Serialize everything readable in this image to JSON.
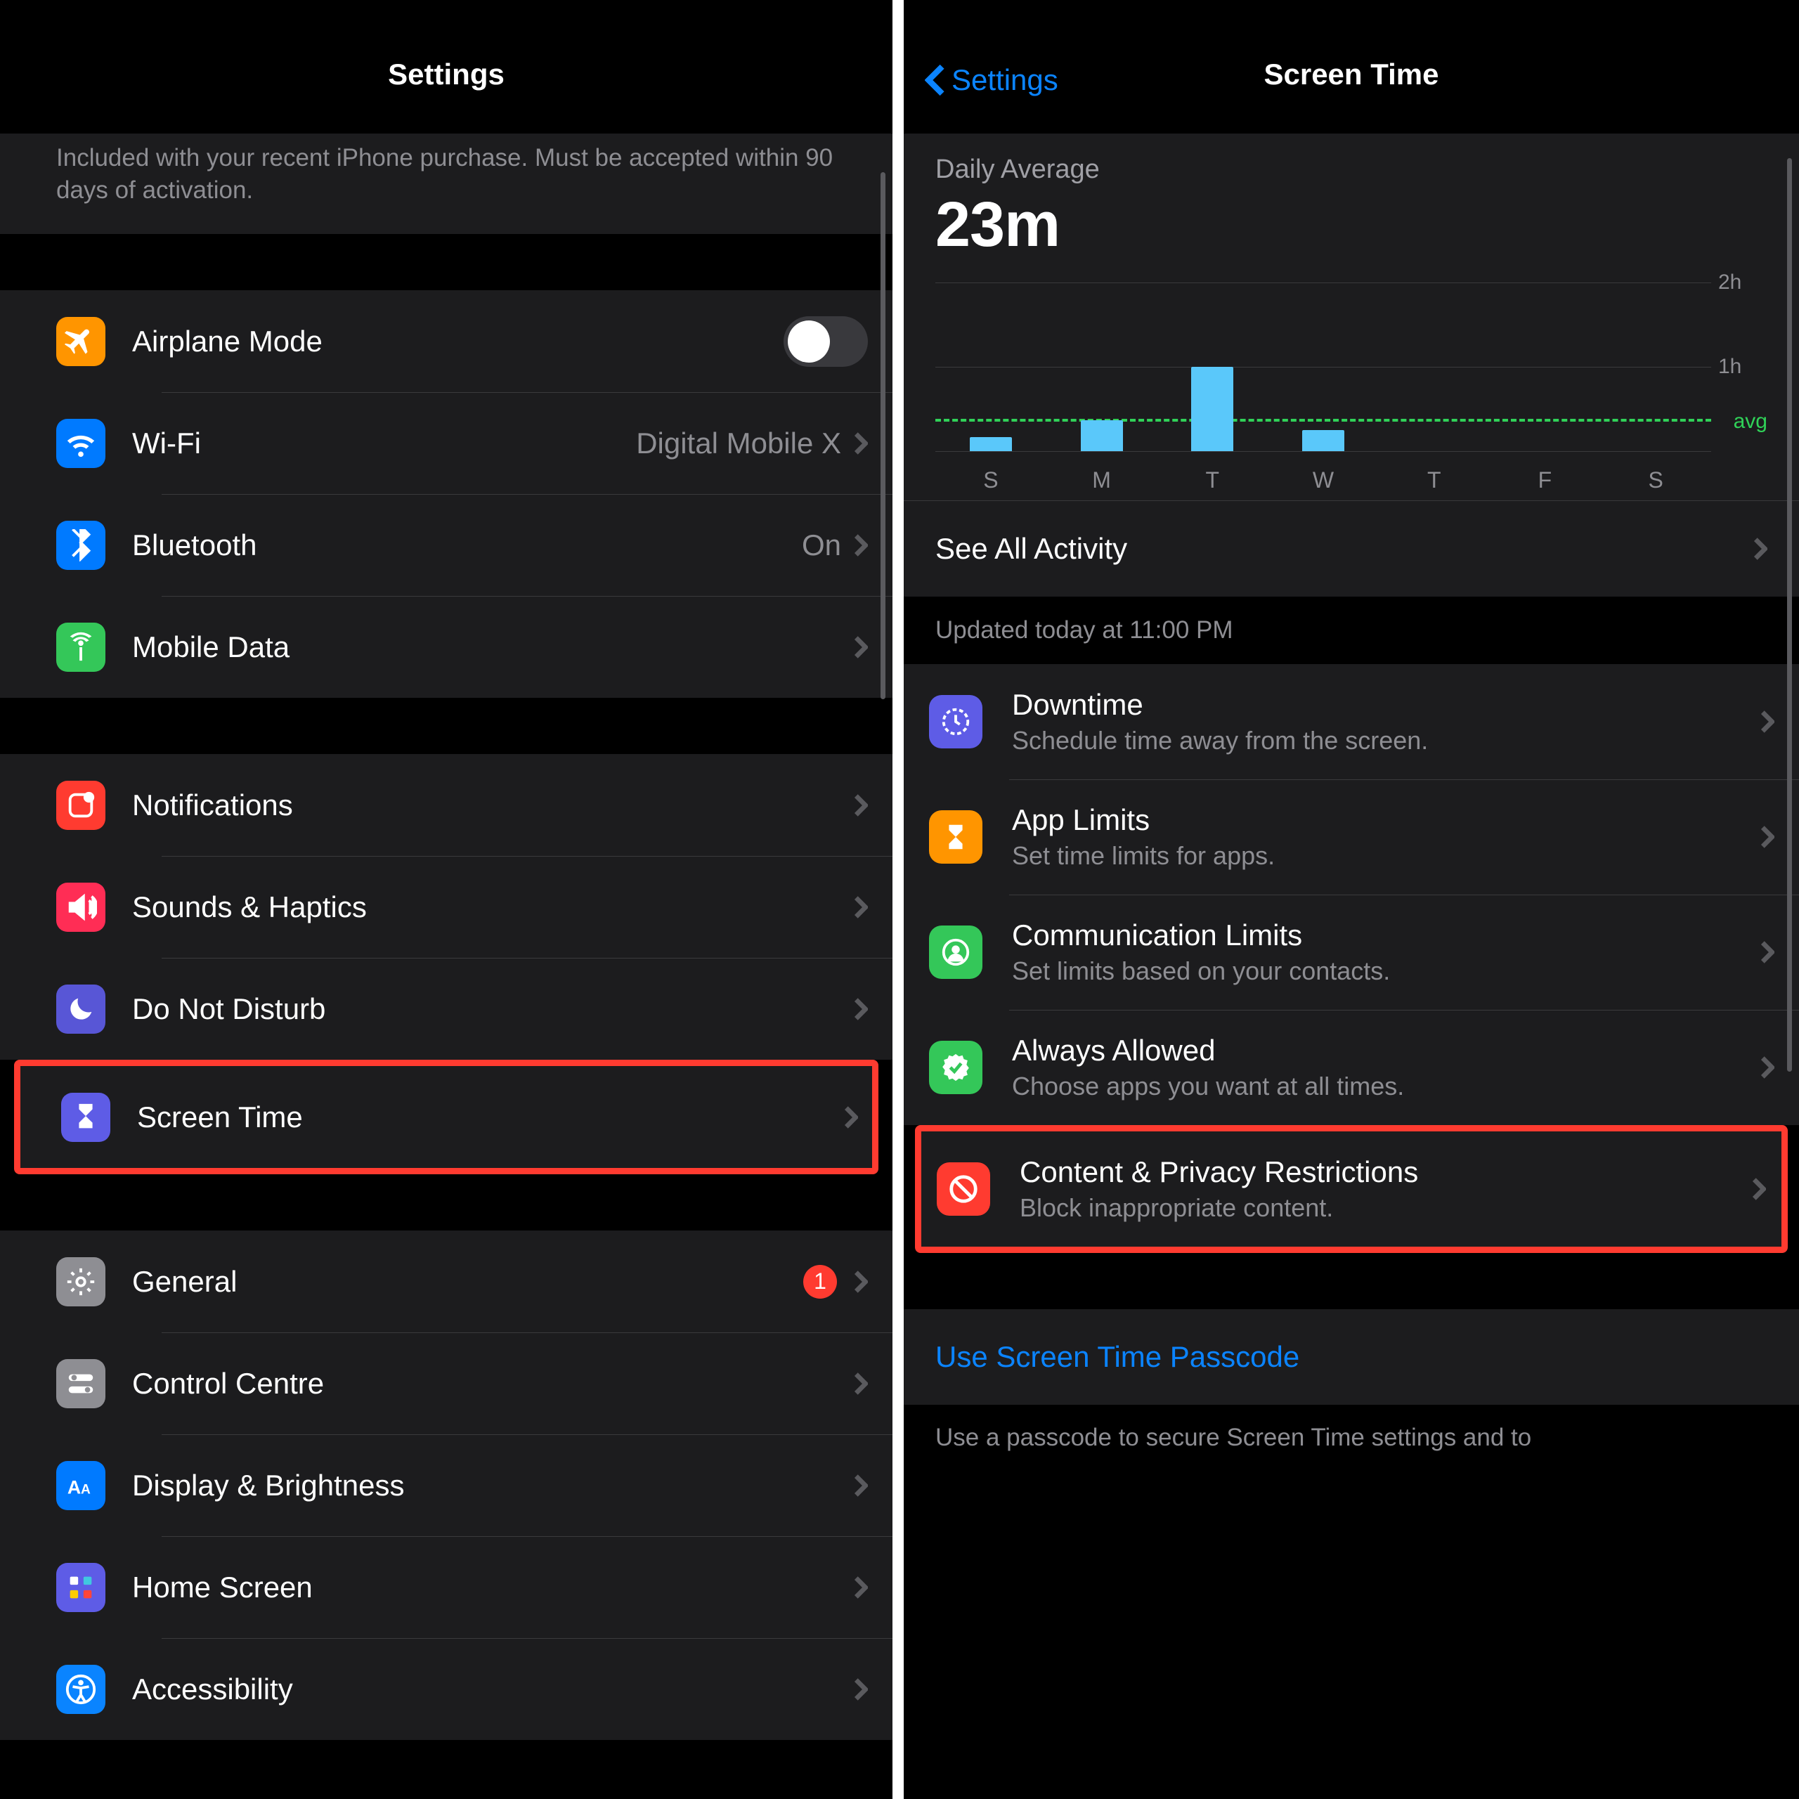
{
  "left": {
    "header_title": "Settings",
    "promo_text": "Included with your recent iPhone purchase. Must be accepted within 90 days of activation.",
    "rows_conn": [
      {
        "label": "Airplane Mode",
        "value": "",
        "toggle": true
      },
      {
        "label": "Wi-Fi",
        "value": "Digital Mobile X"
      },
      {
        "label": "Bluetooth",
        "value": "On"
      },
      {
        "label": "Mobile Data",
        "value": ""
      }
    ],
    "rows_focus": [
      {
        "label": "Notifications"
      },
      {
        "label": "Sounds & Haptics"
      },
      {
        "label": "Do Not Disturb"
      },
      {
        "label": "Screen Time"
      }
    ],
    "rows_general": [
      {
        "label": "General",
        "badge": "1"
      },
      {
        "label": "Control Centre"
      },
      {
        "label": "Display & Brightness"
      },
      {
        "label": "Home Screen"
      },
      {
        "label": "Accessibility"
      }
    ]
  },
  "right": {
    "back_label": "Settings",
    "header_title": "Screen Time",
    "daily_avg_caption": "Daily Average",
    "daily_avg_value": "23m",
    "see_all": "See All Activity",
    "updated": "Updated today at 11:00 PM",
    "options": [
      {
        "title": "Downtime",
        "sub": "Schedule time away from the screen."
      },
      {
        "title": "App Limits",
        "sub": "Set time limits for apps."
      },
      {
        "title": "Communication Limits",
        "sub": "Set limits based on your contacts."
      },
      {
        "title": "Always Allowed",
        "sub": "Choose apps you want at all times."
      },
      {
        "title": "Content & Privacy Restrictions",
        "sub": "Block inappropriate content."
      }
    ],
    "passcode_link": "Use Screen Time Passcode",
    "footer": "Use a passcode to secure Screen Time settings and to"
  },
  "chart_data": {
    "type": "bar",
    "title": "Daily Average Screen Time",
    "categories": [
      "S",
      "M",
      "T",
      "W",
      "T",
      "F",
      "S"
    ],
    "values_minutes": [
      10,
      22,
      60,
      15,
      0,
      0,
      0
    ],
    "avg_minutes": 23,
    "ylim_hours": [
      0,
      2
    ],
    "yticks": [
      "1h",
      "2h"
    ],
    "avg_label": "avg"
  }
}
